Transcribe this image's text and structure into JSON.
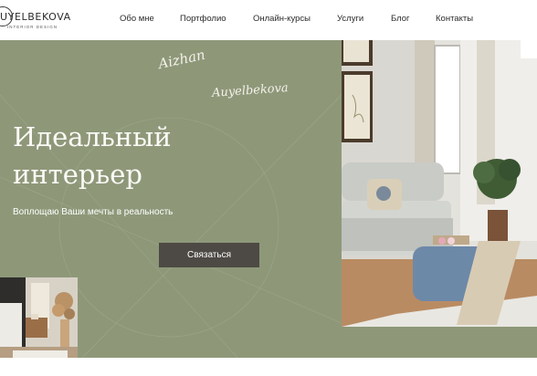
{
  "brand": {
    "name": "UYELBEKOVA",
    "tagline": "INTERIOR DESIGN"
  },
  "nav": {
    "items": [
      "Обо мне",
      "Портфолио",
      "Онлайн-курсы",
      "Услуги",
      "Блог",
      "Контакты"
    ]
  },
  "hero": {
    "signature_first": "Aizhan",
    "signature_last": "Auyelbekova",
    "title_line1": "Идеальный",
    "title_line2": "интерьер",
    "subtitle": "Воплощаю Ваши мечты в реальность",
    "cta_label": "Связаться"
  },
  "colors": {
    "hero_bg": "#8e9879",
    "button_bg": "#4d4a45",
    "text_dark": "#2b2b2b"
  }
}
